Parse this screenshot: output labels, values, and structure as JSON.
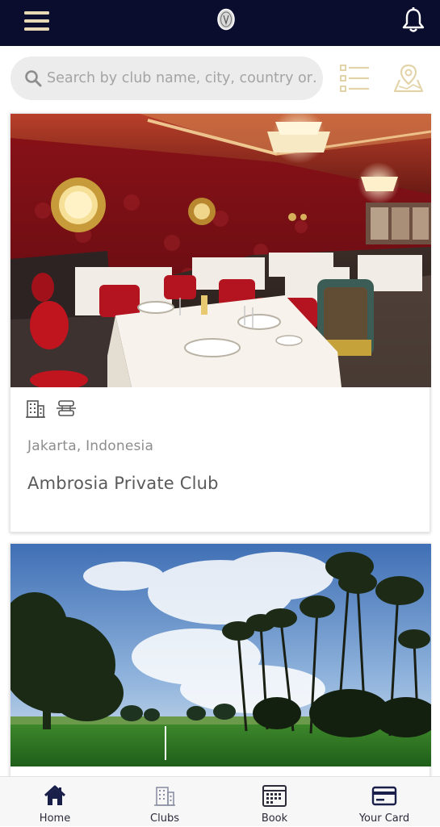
{
  "header": {
    "menu_icon": "hamburger-menu-icon",
    "logo_icon": "club-crest-logo",
    "bell_icon": "notification-bell-icon"
  },
  "search": {
    "placeholder": "Search by club name, city, country or…",
    "icon": "search-icon"
  },
  "toolbar": {
    "list_icon": "list-view-icon",
    "map_icon": "map-pin-icon"
  },
  "clubs": [
    {
      "location": "Jakarta, Indonesia",
      "name": "Ambrosia Private Club",
      "amenities": [
        "building-icon",
        "dining-table-icon"
      ],
      "photo": "restaurant-interior"
    },
    {
      "photo": "golf-course-palms"
    }
  ],
  "bottom_nav": [
    {
      "label": "Home",
      "icon": "home-icon",
      "active": true
    },
    {
      "label": "Clubs",
      "icon": "clubs-building-icon",
      "active": false
    },
    {
      "label": "Book",
      "icon": "calendar-icon",
      "active": false
    },
    {
      "label": "Your Card",
      "icon": "credit-card-icon",
      "active": false
    }
  ],
  "colors": {
    "header_bg": "#0b0d2e",
    "accent_gold": "#e8d9b6",
    "nav_active": "#1a1f4a",
    "nav_inactive": "#8a8fa3"
  }
}
